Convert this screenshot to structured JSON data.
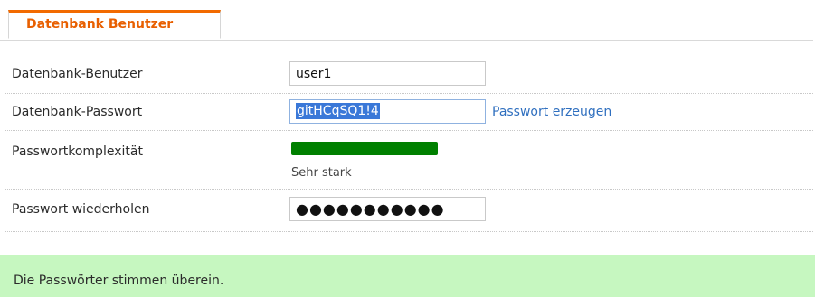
{
  "tab": {
    "label": "Datenbank Benutzer",
    "accent_color": "#f26a00"
  },
  "form": {
    "user": {
      "label": "Datenbank-Benutzer",
      "value": "user1"
    },
    "password": {
      "label": "Datenbank-Passwort",
      "value": "gitHCqSQ1!4",
      "selected": true,
      "generate_link": "Passwort erzeugen"
    },
    "complexity": {
      "label": "Passwortkomplexität",
      "level_fraction": 1.0,
      "strength_text": "Sehr stark",
      "bar_color": "#008000"
    },
    "repeat": {
      "label": "Passwort wiederholen",
      "masked_value": "●●●●●●●●●●●"
    }
  },
  "status": {
    "message": "Die Passwörter stimmen überein.",
    "background_color": "#c6f7c0"
  }
}
